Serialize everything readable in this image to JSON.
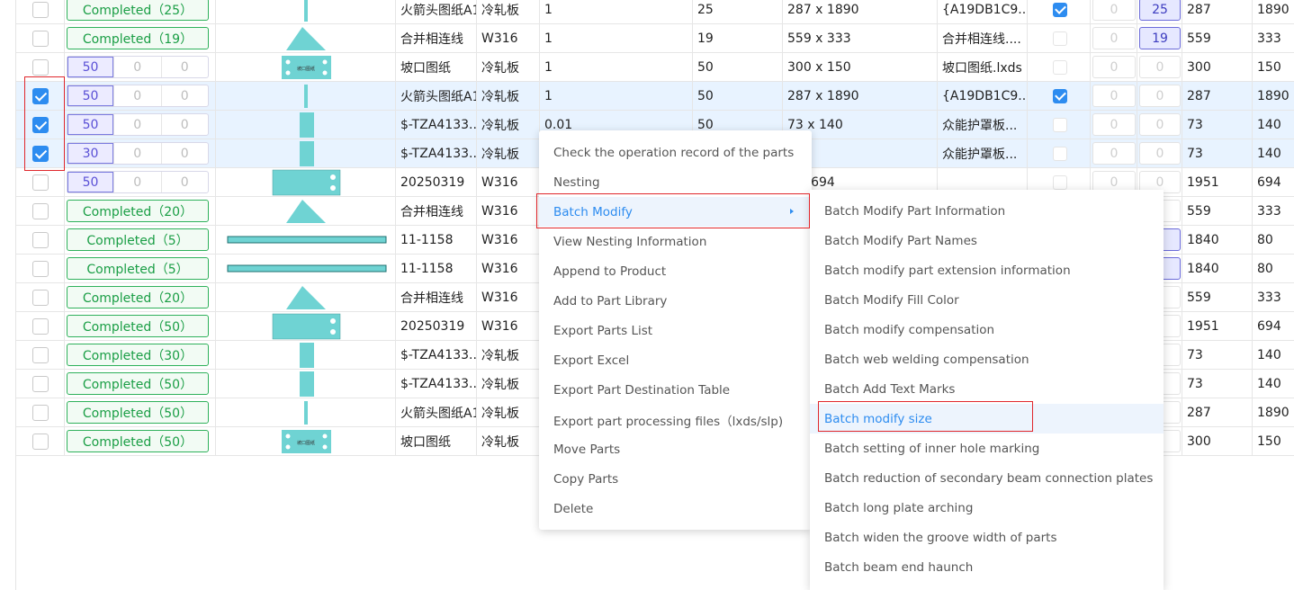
{
  "rows": [
    {
      "checked": false,
      "status": "Completed（25）",
      "name": "火箭头图纸A1",
      "material": "冷轧板",
      "thickness": "1",
      "qty": "25",
      "size": "287 x 1890",
      "file": "{A19DB1C9...",
      "flag": true,
      "a": "0",
      "b": "25",
      "l": "287",
      "w": "1890"
    },
    {
      "checked": false,
      "status": "Completed（19）",
      "name": "合并相连线",
      "material": "W316",
      "thickness": "1",
      "qty": "19",
      "size": "559 x 333",
      "file": "合并相连线....",
      "flag": false,
      "a": "0",
      "b": "19",
      "l": "559",
      "w": "333"
    },
    {
      "checked": false,
      "spin": [
        "50",
        "0",
        "0"
      ],
      "name": "坡口图纸",
      "material": "冷轧板",
      "thickness": "1",
      "qty": "50",
      "size": "300 x 150",
      "file": "坡口图纸.lxds",
      "flag": false,
      "a": "0",
      "b": "0",
      "l": "300",
      "w": "150"
    },
    {
      "checked": true,
      "spin": [
        "50",
        "0",
        "0"
      ],
      "name": "火箭头图纸A1",
      "material": "冷轧板",
      "thickness": "1",
      "qty": "50",
      "size": "287 x 1890",
      "file": "{A19DB1C9...",
      "flag": true,
      "a": "0",
      "b": "0",
      "l": "287",
      "w": "1890"
    },
    {
      "checked": true,
      "spin": [
        "50",
        "0",
        "0"
      ],
      "name": "$-TZA4133...",
      "material": "冷轧板",
      "thickness": "0.01",
      "qty": "50",
      "size": "73 x 140",
      "file": "众能护罩板...",
      "flag": false,
      "a": "0",
      "b": "0",
      "l": "73",
      "w": "140"
    },
    {
      "checked": true,
      "spin": [
        "30",
        "0",
        "0"
      ],
      "name": "$-TZA4133...",
      "material": "冷轧板",
      "thickness": "",
      "qty": "",
      "size": "140",
      "file": "众能护罩板...",
      "flag": false,
      "a": "0",
      "b": "0",
      "l": "73",
      "w": "140"
    },
    {
      "checked": false,
      "spin": [
        "50",
        "0",
        "0"
      ],
      "name": "20250319",
      "material": "W316",
      "thickness": "",
      "qty": "",
      "size": "1 x 694",
      "file": "",
      "flag": false,
      "a": "0",
      "b": "0",
      "l": "1951",
      "w": "694"
    },
    {
      "checked": false,
      "status": "Completed（20）",
      "name": "合并相连线",
      "material": "W316",
      "b": "0",
      "l": "559",
      "w": "333"
    },
    {
      "checked": false,
      "status": "Completed（5）",
      "name": "11-1158",
      "material": "W316",
      "b": "5",
      "l": "1840",
      "w": "80"
    },
    {
      "checked": false,
      "status": "Completed（5）",
      "name": "11-1158",
      "material": "W316",
      "b": "5",
      "l": "1840",
      "w": "80"
    },
    {
      "checked": false,
      "status": "Completed（20）",
      "name": "合并相连线",
      "material": "W316",
      "b": "0",
      "l": "559",
      "w": "333"
    },
    {
      "checked": false,
      "status": "Completed（50）",
      "name": "20250319",
      "material": "W316",
      "b": "0",
      "l": "1951",
      "w": "694"
    },
    {
      "checked": false,
      "status": "Completed（30）",
      "name": "$-TZA4133...",
      "material": "冷轧板",
      "b": "0",
      "l": "73",
      "w": "140"
    },
    {
      "checked": false,
      "status": "Completed（50）",
      "name": "$-TZA4133...",
      "material": "冷轧板",
      "b": "0",
      "l": "73",
      "w": "140"
    },
    {
      "checked": false,
      "status": "Completed（50）",
      "name": "火箭头图纸A1",
      "material": "冷轧板",
      "b": "0",
      "l": "287",
      "w": "1890"
    },
    {
      "checked": false,
      "status": "Completed（50）",
      "name": "坡口图纸",
      "material": "冷轧板",
      "b": "0",
      "l": "300",
      "w": "150"
    }
  ],
  "thumb_label": "坡口图纸",
  "context_menu": {
    "items": [
      "Check the operation record of the parts",
      "Nesting",
      "Batch Modify",
      "View Nesting Information",
      "Append to Product",
      "Add to Part Library",
      "Export Parts List",
      "Export Excel",
      "Export Part Destination Table",
      "Export part processing files（lxds/slp)",
      "Move Parts",
      "Copy Parts",
      "Delete"
    ],
    "active_index": 2
  },
  "submenu": {
    "items": [
      "Batch Modify Part Information",
      "Batch Modify Part Names",
      "Batch modify part extension information",
      "Batch Modify Fill Color",
      "Batch modify compensation",
      "Batch web welding compensation",
      "Batch Add Text Marks",
      "Batch modify size",
      "Batch setting of inner hole marking",
      "Batch reduction of secondary beam connection plates",
      "Batch long plate arching",
      "Batch widen the groove width of parts",
      "Batch beam end haunch"
    ],
    "active_index": 7
  },
  "colors": {
    "accent": "#2d8cf0",
    "completed": "#1a9e45",
    "selected_row": "#e8f3ff",
    "thumb_fill": "#6fd3d3",
    "highlight": "#e0272c"
  }
}
